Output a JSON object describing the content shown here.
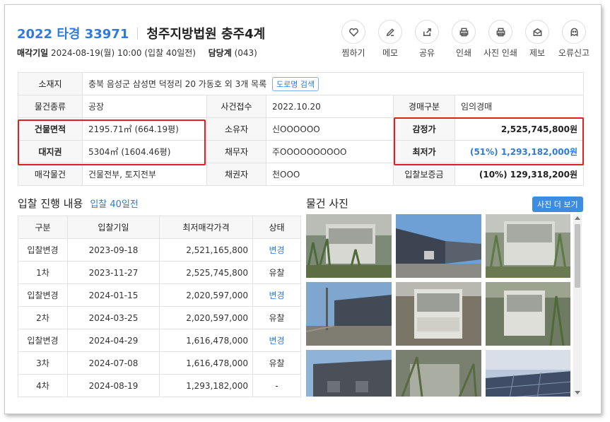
{
  "header": {
    "case_no": "2022 타경 33971",
    "court": "청주지방법원 충주4계",
    "sale_date_label": "매각기일",
    "sale_date_value": "2024-08-19(월) 10:00 (입찰 40일전)",
    "dept_label": "담당계",
    "dept_value": "(043)"
  },
  "actions": [
    {
      "label": "찜하기",
      "icon": "heart-icon"
    },
    {
      "label": "메모",
      "icon": "pencil-icon"
    },
    {
      "label": "공유",
      "icon": "share-icon"
    },
    {
      "label": "인쇄",
      "icon": "printer-icon"
    },
    {
      "label": "사진 인쇄",
      "icon": "printer-icon"
    },
    {
      "label": "제보",
      "icon": "envelope-icon"
    },
    {
      "label": "오류신고",
      "icon": "ghost-icon"
    }
  ],
  "info": {
    "location_label": "소재지",
    "location_value": "충북 음성군 삼성면 덕정리 20 가동호 외 3개 목록",
    "road_search": "도로명 검색",
    "type_label": "물건종류",
    "type_value": "공장",
    "received_label": "사건접수",
    "received_value": "2022.10.20",
    "auction_type_label": "경매구분",
    "auction_type_value": "임의경매",
    "building_area_label": "건물면적",
    "building_area_value": "2195.71㎡ (664.19평)",
    "owner_label": "소유자",
    "owner_value": "신OOOOOO",
    "appraisal_label": "감정가",
    "appraisal_value": "2,525,745,800원",
    "land_label": "대지권",
    "land_value": "5304㎡ (1604.46평)",
    "debtor_label": "채무자",
    "debtor_value": "주OOOOOOOOOO",
    "min_price_label": "최저가",
    "min_price_value": "(51%) 1,293,182,000원",
    "sale_item_label": "매각물건",
    "sale_item_value": "건물전부, 토지전부",
    "creditor_label": "채권자",
    "creditor_value": "천OOO",
    "deposit_label": "입찰보증금",
    "deposit_value": "(10%) 129,318,200원"
  },
  "bidding": {
    "title": "입찰 진행 내용",
    "subtitle": "입찰 40일전",
    "columns": [
      "구분",
      "입찰기일",
      "최저매각가격",
      "상태"
    ],
    "rows": [
      {
        "round": "입찰변경",
        "date": "2023-09-18",
        "price": "2,521,165,800",
        "status": "변경"
      },
      {
        "round": "1차",
        "date": "2023-11-27",
        "price": "2,525,745,800",
        "status": "유찰"
      },
      {
        "round": "입찰변경",
        "date": "2024-01-15",
        "price": "2,020,597,000",
        "status": "변경"
      },
      {
        "round": "2차",
        "date": "2024-03-25",
        "price": "2,020,597,000",
        "status": "유찰"
      },
      {
        "round": "입찰변경",
        "date": "2024-04-29",
        "price": "1,616,478,000",
        "status": "변경"
      },
      {
        "round": "3차",
        "date": "2024-07-08",
        "price": "1,616,478,000",
        "status": "유찰"
      },
      {
        "round": "4차",
        "date": "2024-08-19",
        "price": "1,293,182,000",
        "status": "-"
      }
    ]
  },
  "photos": {
    "title": "물건 사진",
    "more_button": "사진 더 보기"
  },
  "colors": {
    "accent": "#2f7bd6",
    "highlight": "#e02020",
    "button": "#3d8ce0"
  }
}
